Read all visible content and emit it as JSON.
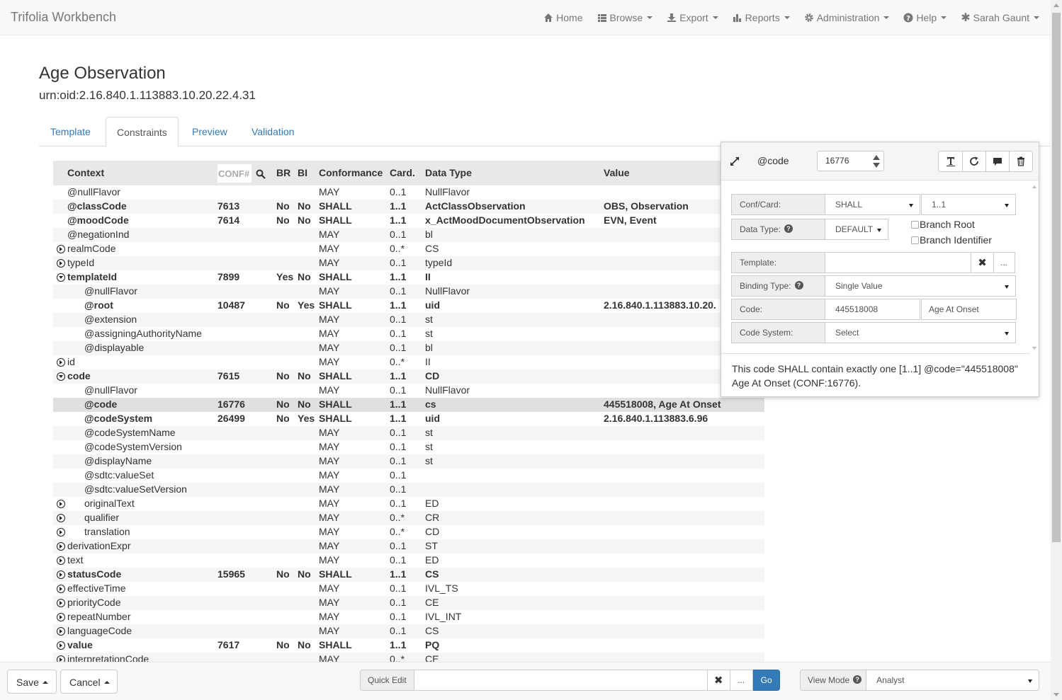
{
  "app": {
    "brand": "Trifolia Workbench"
  },
  "nav": {
    "home": "Home",
    "browse": "Browse",
    "export": "Export",
    "reports": "Reports",
    "administration": "Administration",
    "help": "Help",
    "user": "Sarah Gaunt"
  },
  "page": {
    "title": "Age Observation",
    "oid": "urn:oid:2.16.840.1.113883.10.20.22.4.31"
  },
  "tabs": [
    "Template",
    "Constraints",
    "Preview",
    "Validation"
  ],
  "active_tab": "Constraints",
  "table": {
    "headers": {
      "context": "Context",
      "conf": "CONF#",
      "br": "BR",
      "bi": "BI",
      "conformance": "Conformance",
      "card": "Card.",
      "datatype": "Data Type",
      "value": "Value"
    },
    "rows": [
      {
        "context": "@nullFlavor",
        "indent": 0,
        "exp": "",
        "conf": "",
        "br": "",
        "bi": "",
        "conformance": "MAY",
        "card": "0..1",
        "type": "NullFlavor",
        "value": "",
        "bold": false
      },
      {
        "context": "@classCode",
        "indent": 0,
        "exp": "",
        "conf": "7613",
        "br": "No",
        "bi": "No",
        "conformance": "SHALL",
        "card": "1..1",
        "type": "ActClassObservation",
        "value": "OBS, Observation",
        "bold": true
      },
      {
        "context": "@moodCode",
        "indent": 0,
        "exp": "",
        "conf": "7614",
        "br": "No",
        "bi": "No",
        "conformance": "SHALL",
        "card": "1..1",
        "type": "x_ActMoodDocumentObservation",
        "value": "EVN, Event",
        "bold": true
      },
      {
        "context": "@negationInd",
        "indent": 0,
        "exp": "",
        "conf": "",
        "br": "",
        "bi": "",
        "conformance": "MAY",
        "card": "0..1",
        "type": "bl",
        "value": "",
        "bold": false
      },
      {
        "context": "realmCode",
        "indent": 0,
        "exp": "collapsed",
        "conf": "",
        "br": "",
        "bi": "",
        "conformance": "MAY",
        "card": "0..*",
        "type": "CS",
        "value": "",
        "bold": false
      },
      {
        "context": "typeId",
        "indent": 0,
        "exp": "collapsed",
        "conf": "",
        "br": "",
        "bi": "",
        "conformance": "MAY",
        "card": "0..1",
        "type": "typeId",
        "value": "",
        "bold": false
      },
      {
        "context": "templateId",
        "indent": 0,
        "exp": "expanded",
        "conf": "7899",
        "br": "Yes",
        "bi": "No",
        "conformance": "SHALL",
        "card": "1..1",
        "type": "II",
        "value": "",
        "bold": true
      },
      {
        "context": "@nullFlavor",
        "indent": 1,
        "exp": "",
        "conf": "",
        "br": "",
        "bi": "",
        "conformance": "MAY",
        "card": "0..1",
        "type": "NullFlavor",
        "value": "",
        "bold": false
      },
      {
        "context": "@root",
        "indent": 1,
        "exp": "",
        "conf": "10487",
        "br": "No",
        "bi": "Yes",
        "conformance": "SHALL",
        "card": "1..1",
        "type": "uid",
        "value": "2.16.840.1.113883.10.20.",
        "bold": true
      },
      {
        "context": "@extension",
        "indent": 1,
        "exp": "",
        "conf": "",
        "br": "",
        "bi": "",
        "conformance": "MAY",
        "card": "0..1",
        "type": "st",
        "value": "",
        "bold": false
      },
      {
        "context": "@assigningAuthorityName",
        "indent": 1,
        "exp": "",
        "conf": "",
        "br": "",
        "bi": "",
        "conformance": "MAY",
        "card": "0..1",
        "type": "st",
        "value": "",
        "bold": false
      },
      {
        "context": "@displayable",
        "indent": 1,
        "exp": "",
        "conf": "",
        "br": "",
        "bi": "",
        "conformance": "MAY",
        "card": "0..1",
        "type": "bl",
        "value": "",
        "bold": false
      },
      {
        "context": "id",
        "indent": 0,
        "exp": "collapsed",
        "conf": "",
        "br": "",
        "bi": "",
        "conformance": "MAY",
        "card": "0..*",
        "type": "II",
        "value": "",
        "bold": false
      },
      {
        "context": "code",
        "indent": 0,
        "exp": "expanded",
        "conf": "7615",
        "br": "No",
        "bi": "No",
        "conformance": "SHALL",
        "card": "1..1",
        "type": "CD",
        "value": "",
        "bold": true
      },
      {
        "context": "@nullFlavor",
        "indent": 1,
        "exp": "",
        "conf": "",
        "br": "",
        "bi": "",
        "conformance": "MAY",
        "card": "0..1",
        "type": "NullFlavor",
        "value": "",
        "bold": false
      },
      {
        "context": "@code",
        "indent": 1,
        "exp": "",
        "conf": "16776",
        "br": "No",
        "bi": "No",
        "conformance": "SHALL",
        "card": "1..1",
        "type": "cs",
        "value": "445518008, Age At Onset",
        "bold": true,
        "selected": true
      },
      {
        "context": "@codeSystem",
        "indent": 1,
        "exp": "",
        "conf": "26499",
        "br": "No",
        "bi": "Yes",
        "conformance": "SHALL",
        "card": "1..1",
        "type": "uid",
        "value": "2.16.840.1.113883.6.96",
        "bold": true
      },
      {
        "context": "@codeSystemName",
        "indent": 1,
        "exp": "",
        "conf": "",
        "br": "",
        "bi": "",
        "conformance": "MAY",
        "card": "0..1",
        "type": "st",
        "value": "",
        "bold": false
      },
      {
        "context": "@codeSystemVersion",
        "indent": 1,
        "exp": "",
        "conf": "",
        "br": "",
        "bi": "",
        "conformance": "MAY",
        "card": "0..1",
        "type": "st",
        "value": "",
        "bold": false
      },
      {
        "context": "@displayName",
        "indent": 1,
        "exp": "",
        "conf": "",
        "br": "",
        "bi": "",
        "conformance": "MAY",
        "card": "0..1",
        "type": "st",
        "value": "",
        "bold": false
      },
      {
        "context": "@sdtc:valueSet",
        "indent": 1,
        "exp": "",
        "conf": "",
        "br": "",
        "bi": "",
        "conformance": "MAY",
        "card": "0..1",
        "type": "",
        "value": "",
        "bold": false
      },
      {
        "context": "@sdtc:valueSetVersion",
        "indent": 1,
        "exp": "",
        "conf": "",
        "br": "",
        "bi": "",
        "conformance": "MAY",
        "card": "0..1",
        "type": "",
        "value": "",
        "bold": false
      },
      {
        "context": "originalText",
        "indent": 1,
        "exp": "collapsed",
        "conf": "",
        "br": "",
        "bi": "",
        "conformance": "MAY",
        "card": "0..1",
        "type": "ED",
        "value": "",
        "bold": false
      },
      {
        "context": "qualifier",
        "indent": 1,
        "exp": "collapsed",
        "conf": "",
        "br": "",
        "bi": "",
        "conformance": "MAY",
        "card": "0..*",
        "type": "CR",
        "value": "",
        "bold": false
      },
      {
        "context": "translation",
        "indent": 1,
        "exp": "collapsed",
        "conf": "",
        "br": "",
        "bi": "",
        "conformance": "MAY",
        "card": "0..*",
        "type": "CD",
        "value": "",
        "bold": false
      },
      {
        "context": "derivationExpr",
        "indent": 0,
        "exp": "collapsed",
        "conf": "",
        "br": "",
        "bi": "",
        "conformance": "MAY",
        "card": "0..1",
        "type": "ST",
        "value": "",
        "bold": false
      },
      {
        "context": "text",
        "indent": 0,
        "exp": "collapsed",
        "conf": "",
        "br": "",
        "bi": "",
        "conformance": "MAY",
        "card": "0..1",
        "type": "ED",
        "value": "",
        "bold": false
      },
      {
        "context": "statusCode",
        "indent": 0,
        "exp": "collapsed",
        "conf": "15965",
        "br": "No",
        "bi": "No",
        "conformance": "SHALL",
        "card": "1..1",
        "type": "CS",
        "value": "",
        "bold": true
      },
      {
        "context": "effectiveTime",
        "indent": 0,
        "exp": "collapsed",
        "conf": "",
        "br": "",
        "bi": "",
        "conformance": "MAY",
        "card": "0..1",
        "type": "IVL_TS",
        "value": "",
        "bold": false
      },
      {
        "context": "priorityCode",
        "indent": 0,
        "exp": "collapsed",
        "conf": "",
        "br": "",
        "bi": "",
        "conformance": "MAY",
        "card": "0..1",
        "type": "CE",
        "value": "",
        "bold": false
      },
      {
        "context": "repeatNumber",
        "indent": 0,
        "exp": "collapsed",
        "conf": "",
        "br": "",
        "bi": "",
        "conformance": "MAY",
        "card": "0..1",
        "type": "IVL_INT",
        "value": "",
        "bold": false
      },
      {
        "context": "languageCode",
        "indent": 0,
        "exp": "collapsed",
        "conf": "",
        "br": "",
        "bi": "",
        "conformance": "MAY",
        "card": "0..1",
        "type": "CS",
        "value": "",
        "bold": false
      },
      {
        "context": "value",
        "indent": 0,
        "exp": "collapsed",
        "conf": "7617",
        "br": "No",
        "bi": "No",
        "conformance": "SHALL",
        "card": "1..1",
        "type": "PQ",
        "value": "",
        "bold": true
      },
      {
        "context": "interpretationCode",
        "indent": 0,
        "exp": "collapsed",
        "conf": "",
        "br": "",
        "bi": "",
        "conformance": "MAY",
        "card": "0..*",
        "type": "CE",
        "value": "",
        "bold": false
      }
    ]
  },
  "panel": {
    "field_label": "@code",
    "conf_number": "16776",
    "conf_card_label": "Conf/Card:",
    "conformance": "SHALL",
    "cardinality": "1..1",
    "data_type_label": "Data Type:",
    "data_type": "DEFAULT",
    "branch_root": "Branch Root",
    "branch_identifier": "Branch Identifier",
    "template_label": "Template:",
    "template_value": "",
    "template_browse": "...",
    "binding_type_label": "Binding Type:",
    "binding_type": "Single Value",
    "code_label": "Code:",
    "code_value": "445518008",
    "code_display": "Age At Onset",
    "code_system_label": "Code System:",
    "code_system": "Select",
    "narrative": "This code SHALL contain exactly one [1..1] @code=\"445518008\" Age At Onset (CONF:16776)."
  },
  "bottom": {
    "save": "Save",
    "cancel": "Cancel",
    "quick_edit_label": "Quick Edit",
    "quick_edit_value": "",
    "browse": "...",
    "go": "Go",
    "view_mode_label": "View Mode",
    "view_mode": "Analyst"
  },
  "colors": {
    "primary": "#337ab7",
    "link": "#337ab7",
    "navbar_bg": "#f8f8f8",
    "header_bg": "#e8e8e8"
  }
}
